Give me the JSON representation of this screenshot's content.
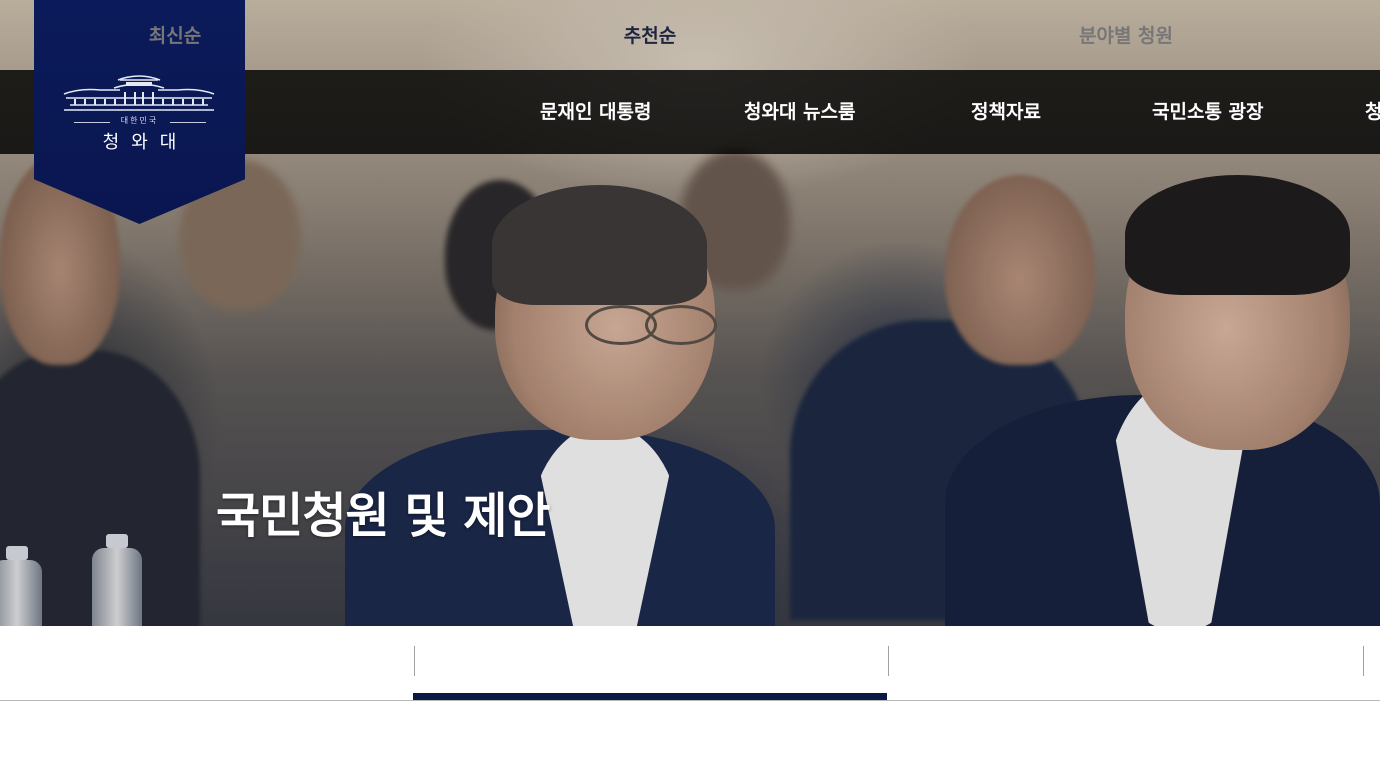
{
  "logo": {
    "small_text": "대한민국",
    "name": "청와대"
  },
  "nav": {
    "items": [
      {
        "label": "문재인 대통령"
      },
      {
        "label": "청와대 뉴스룸"
      },
      {
        "label": "정책자료"
      },
      {
        "label": "국민소통 광장"
      },
      {
        "label": "청"
      }
    ]
  },
  "hero": {
    "title": "국민청원 및 제안"
  },
  "tabs": {
    "items": [
      {
        "label": "최신순",
        "active": false
      },
      {
        "label": "추천순",
        "active": true
      },
      {
        "label": "분야별 청원",
        "active": false
      }
    ]
  },
  "colors": {
    "navy": "#0b1a45",
    "logo_bg": "#0b1a5a",
    "tab_inactive": "#777777",
    "tab_active": "#1d2540"
  }
}
